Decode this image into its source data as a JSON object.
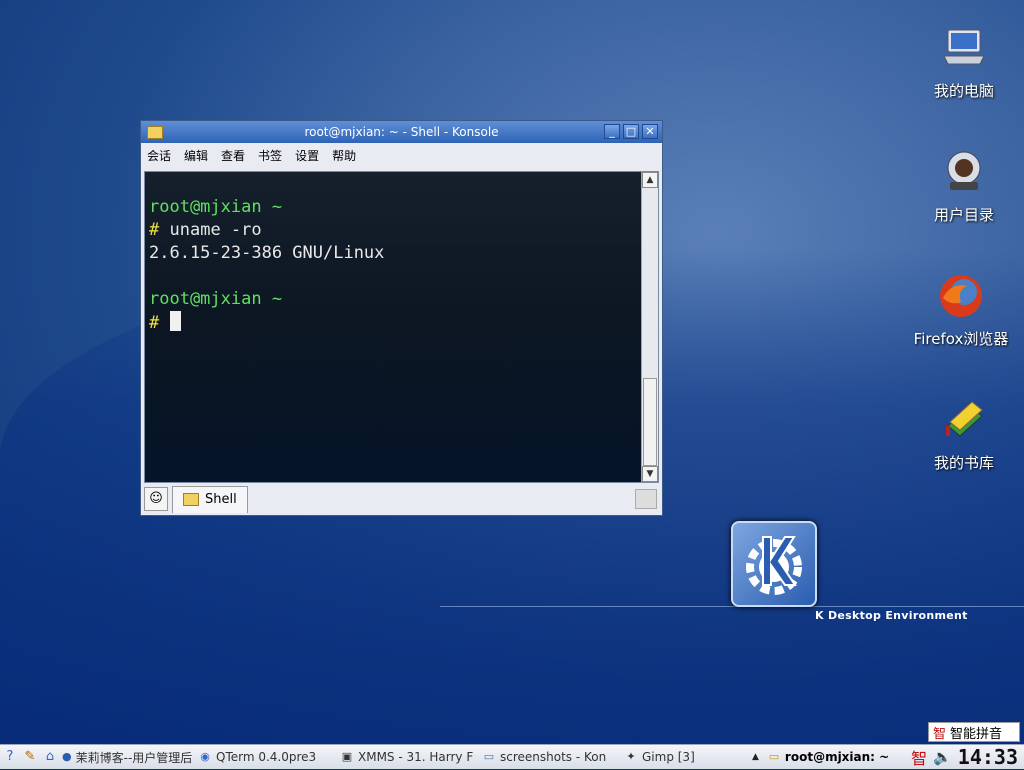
{
  "desktop": {
    "icons": [
      {
        "label": "我的电脑",
        "icon": "computer-icon"
      },
      {
        "label": "用户目录",
        "icon": "home-folder-icon"
      },
      {
        "label": "Firefox浏览器",
        "icon": "firefox-icon"
      },
      {
        "label": "我的书库",
        "icon": "books-icon"
      }
    ],
    "kde_caption": "K Desktop Environment"
  },
  "window": {
    "title": "root@mjxian: ~ - Shell - Konsole",
    "menu": [
      "会话",
      "编辑",
      "查看",
      "书签",
      "设置",
      "帮助"
    ],
    "terminal": {
      "prompt1": "root@mjxian ~",
      "cmd1_prompt": "#",
      "cmd1": "uname -ro",
      "output1": "2.6.15-23-386 GNU/Linux",
      "prompt2": "root@mjxian ~",
      "cmd2_prompt": "#"
    },
    "tab_label": "Shell"
  },
  "taskbar": {
    "tasks": [
      {
        "label": "茉莉博客--用户管理后",
        "icon": "globe-icon"
      },
      {
        "label": "QTerm 0.4.0pre3",
        "icon": "qterm-icon"
      },
      {
        "label": "XMMS - 31. Harry F",
        "icon": "xmms-icon"
      },
      {
        "label": "screenshots - Kon",
        "icon": "folder-icon"
      },
      {
        "label": "Gimp [3]",
        "icon": "gimp-icon"
      },
      {
        "label": "root@mjxian: ~",
        "icon": "konsole-icon",
        "active": true
      }
    ],
    "ime_label": "智能拼音",
    "ime_glyph": "智",
    "tray_glyph": "智",
    "clock": "14:33"
  }
}
